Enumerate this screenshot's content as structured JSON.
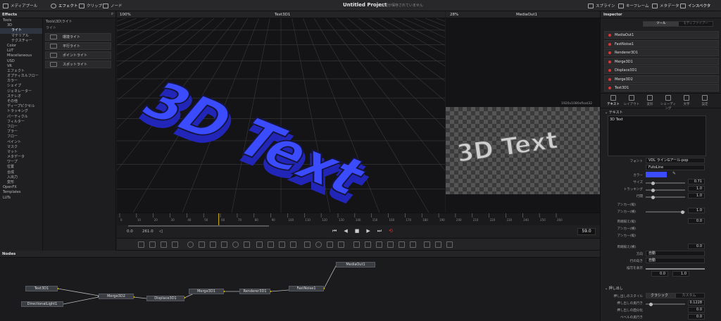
{
  "topbar": {
    "media_pool": "メディアプール",
    "effects": "エフェクト",
    "clips": "クリップ",
    "nodes": "ノード",
    "project_title": "Untitled Project",
    "status": "変更が保存されていません",
    "spline": "スプライン",
    "keyframes": "キーフレーム",
    "metadata": "メタデータ",
    "inspector": "インスペクタ"
  },
  "effects": {
    "title": "Effects",
    "tree": [
      "Tools",
      "3D",
      "ライト",
      "マテリアル",
      "テクスチャー",
      "Color",
      "LUT",
      "Miscellaneous",
      "USD",
      "VR",
      "エフェクト",
      "オプティカルフロー",
      "カラー",
      "シェイプ",
      "ジェネレーター",
      "ステレオ",
      "その他",
      "ディープピクセル",
      "トラッキング",
      "パーティクル",
      "フィルター",
      "フロー",
      "ブラー",
      "フロー",
      "ペイント",
      "マスク",
      "マット",
      "メタデータ",
      "ワープ",
      "位置",
      "合成",
      "入出力",
      "変形",
      "OpenFX",
      "Templates",
      "LUTs"
    ],
    "path": "Tools\\3D\\ライト",
    "sub": "ライト",
    "tools": [
      "環境ライト",
      "平行ライト",
      "ポイントライト",
      "スポットライト"
    ]
  },
  "viewer1": {
    "zoom": "100%",
    "title": "Text3D1",
    "text": "3D Text"
  },
  "viewer2": {
    "zoom": "28%",
    "title": "MediaOut1",
    "resolution": "1920x1080xfloat32",
    "text": "3D Text"
  },
  "transport": {
    "in": "0.0",
    "out": "261.0",
    "current": "59.0"
  },
  "ruler_ticks": [
    "0",
    "10",
    "20",
    "30",
    "40",
    "50",
    "60",
    "70",
    "80",
    "90",
    "100",
    "110",
    "120",
    "130",
    "140",
    "150",
    "160",
    "170",
    "180",
    "190",
    "200",
    "210",
    "220",
    "230",
    "240",
    "250",
    "260"
  ],
  "nodes": {
    "title": "Nodes",
    "list": [
      "MediaOut1",
      "Text3D1",
      "Merge3D2",
      "Displace3D1",
      "Merge3D1",
      "Renderer3D1",
      "FastNoise1",
      "DirectionalLight1"
    ]
  },
  "inspector": {
    "title": "Inspector",
    "tab_tool": "ツール",
    "tab_modifier": "モディファイアー",
    "node_list": [
      "MediaOut1",
      "FastNoise1",
      "Renderer3D1",
      "Merge3D1",
      "Displace3D1",
      "Merge3D2",
      "Text3D1"
    ],
    "sub_tabs": [
      "テキスト",
      "レイアウト",
      "変形",
      "シェーディング",
      "文字",
      "設定"
    ],
    "section_text": "テキスト",
    "text_value": "3D Text",
    "font_label": "フォント",
    "font_value": "VDL ラインGアール-pop",
    "font_style": "FutoLine",
    "color_label": "カラー",
    "color_value": "#3b4cff",
    "size_label": "サイズ",
    "size_value": "0.71",
    "tracking_label": "トラッキング",
    "tracking_value": "1.0",
    "line_label": "行間",
    "line_value": "1.0",
    "anchor_v_label": "アンカー(縦)",
    "anchor_h_label": "アンカー(横)",
    "anchor_h_value": "1.0",
    "just_label": "両端揃え(縦)",
    "just_value": "0.0",
    "anchor_h2_label": "アンカー(横)",
    "anchor_v2_label": "アンカー(縦)",
    "just2_label": "両端揃え(横)",
    "just2_value": "0.0",
    "dir_label": "方向",
    "dir_value": "自動",
    "line_dir_label": "行の向き",
    "line_dir_value": "自動",
    "write_label": "描写を表示",
    "write_a": "0.0",
    "write_b": "1.0",
    "section_extrude": "押し出し",
    "ext_style_label": "押し出しのスタイル",
    "ext_style_a": "クラシック",
    "ext_style_b": "カスタム",
    "ext_depth_label": "押し出しの奥行き",
    "ext_depth_value": "0.1228",
    "bevel_depth_label": "押し出しの面分化",
    "bevel_depth_value": "0.0",
    "bevel_width_label": "ベベルの奥行き",
    "bevel_width_value": "0.0"
  },
  "colors": {
    "accent": "#3a49ff",
    "node_red": "#d33333",
    "yellow_line": "#e0c020"
  }
}
